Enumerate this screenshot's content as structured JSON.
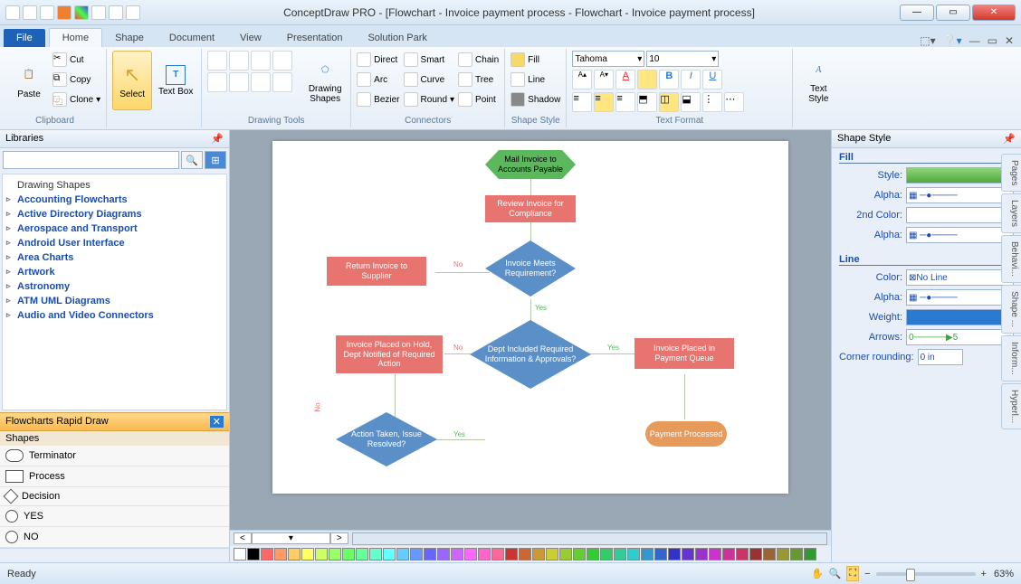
{
  "titlebar": {
    "title": "ConceptDraw PRO - [Flowchart - Invoice payment process - Flowchart - Invoice payment process]"
  },
  "window_buttons": {
    "min": "—",
    "max": "▭",
    "close": "✕"
  },
  "tabs": {
    "file": "File",
    "items": [
      "Home",
      "Shape",
      "Document",
      "View",
      "Presentation",
      "Solution Park"
    ],
    "active": "Home"
  },
  "ribbon": {
    "clipboard": {
      "label": "Clipboard",
      "paste": "Paste",
      "cut": "Cut",
      "copy": "Copy",
      "clone": "Clone"
    },
    "select_group": {
      "select": "Select",
      "textbox": "Text Box"
    },
    "drawing": {
      "label": "Drawing Tools",
      "shapes": "Drawing Shapes"
    },
    "connectors": {
      "label": "Connectors",
      "direct": "Direct",
      "smart": "Smart",
      "arc": "Arc",
      "curve": "Curve",
      "bezier": "Bezier",
      "round": "Round"
    },
    "connectors2": {
      "chain": "Chain",
      "tree": "Tree",
      "point": "Point"
    },
    "shape_style": {
      "label": "Shape Style",
      "fill": "Fill",
      "line": "Line",
      "shadow": "Shadow"
    },
    "font": {
      "name": "Tahoma",
      "size": "10",
      "label": "Text Format"
    },
    "text_style": {
      "label": "Text Style"
    }
  },
  "libraries": {
    "title": "Libraries",
    "search_placeholder": "",
    "items": [
      "Drawing Shapes",
      "Accounting Flowcharts",
      "Active Directory Diagrams",
      "Aerospace and Transport",
      "Android User Interface",
      "Area Charts",
      "Artwork",
      "Astronomy",
      "ATM UML Diagrams",
      "Audio and Video Connectors"
    ]
  },
  "rapid_draw": {
    "title": "Flowcharts Rapid Draw",
    "sub": "Shapes",
    "shapes": [
      "Terminator",
      "Process",
      "Decision",
      "YES",
      "NO"
    ]
  },
  "flowchart": {
    "n1": "Mail Invoice to Accounts Payable",
    "n2": "Review Invoice for Compliance",
    "n3": "Invoice Meets Requirement?",
    "n4": "Return Invoice to Supplier",
    "n5": "Dept Included Required Information & Approvals?",
    "n6": "Invoice Placed on Hold, Dept Notified of Required Action",
    "n7": "Invoice Placed in Payment Queue",
    "n8": "Action Taken, Issue Resolved?",
    "n9": "Payment Processed",
    "yes": "Yes",
    "no": "No"
  },
  "shape_style_pane": {
    "title": "Shape Style",
    "fill": "Fill",
    "line": "Line",
    "style": "Style:",
    "alpha": "Alpha:",
    "color2": "2nd Color:",
    "color": "Color:",
    "weight": "Weight:",
    "arrows": "Arrows:",
    "rounding": "Corner rounding:",
    "rounding_val": "0 in",
    "noline": "No Line"
  },
  "side_tabs": [
    "Pages",
    "Layers",
    "Behavi...",
    "Shape ...",
    "Inform...",
    "Hyperl..."
  ],
  "palette": [
    "#ffffff",
    "#000000",
    "#ff6666",
    "#ff9966",
    "#ffcc66",
    "#ffff66",
    "#ccff66",
    "#99ff66",
    "#66ff66",
    "#66ff99",
    "#66ffcc",
    "#66ffff",
    "#66ccff",
    "#6699ff",
    "#6666ff",
    "#9966ff",
    "#cc66ff",
    "#ff66ff",
    "#ff66cc",
    "#ff6699",
    "#cc3333",
    "#cc6633",
    "#cc9933",
    "#cccc33",
    "#99cc33",
    "#66cc33",
    "#33cc33",
    "#33cc66",
    "#33cc99",
    "#33cccc",
    "#3399cc",
    "#3366cc",
    "#3333cc",
    "#6633cc",
    "#9933cc",
    "#cc33cc",
    "#cc3399",
    "#cc3366",
    "#993333",
    "#996633",
    "#999933",
    "#669933",
    "#339933"
  ],
  "statusbar": {
    "ready": "Ready",
    "zoom": "63%"
  }
}
